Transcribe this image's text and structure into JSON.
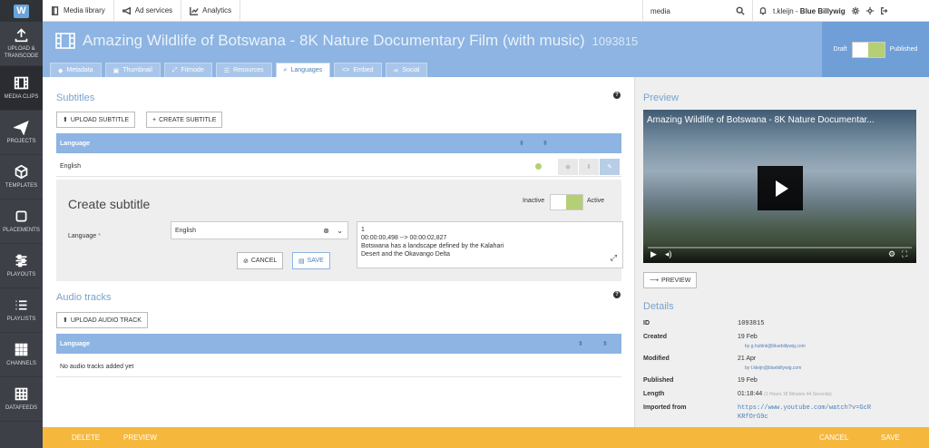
{
  "nav": {
    "items": [
      {
        "label": "UPLOAD &\nTRANSCODE",
        "icon": "upload-icon"
      },
      {
        "label": "MEDIA CLIPS",
        "icon": "film-icon"
      },
      {
        "label": "PROJECTS",
        "icon": "paper-plane-icon"
      },
      {
        "label": "TEMPLATES",
        "icon": "cube-icon"
      },
      {
        "label": "PLACEMENTS",
        "icon": "square-icon"
      },
      {
        "label": "PLAYOUTS",
        "icon": "sliders-icon"
      },
      {
        "label": "PLAYLISTS",
        "icon": "list-icon"
      },
      {
        "label": "CHANNELS",
        "icon": "grid-icon"
      },
      {
        "label": "DATAFEEDS",
        "icon": "table-icon"
      }
    ]
  },
  "topbar": {
    "media_library": "Media library",
    "ad_services": "Ad services",
    "analytics": "Analytics",
    "search_value": "media",
    "user": "t.kleijn",
    "account": "Blue Billywig"
  },
  "header": {
    "title": "Amazing Wildlife of Botswana - 8K Nature Documentary Film (with music)",
    "id": "1093815",
    "draft_label": "Draft",
    "published_label": "Published"
  },
  "tabs": [
    "Metadata",
    "Thumbnail",
    "Fitmode",
    "Resources",
    "Languages",
    "Embed",
    "Social"
  ],
  "subtitles": {
    "heading": "Subtitles",
    "upload_label": "UPLOAD SUBTITLE",
    "create_label": "CREATE SUBTITLE",
    "col_language": "Language",
    "rows": [
      {
        "language": "English"
      }
    ]
  },
  "create": {
    "heading": "Create subtitle",
    "inactive": "Inactive",
    "active": "Active",
    "language_label": "Language",
    "required_mark": "*",
    "language_value": "English",
    "cancel": "CANCEL",
    "save": "SAVE",
    "text_lines": [
      "1",
      "00:00:00,498 --> 00:00:02,827",
      "Botswana has a landscape defined by the Kalahari",
      "Desert and the Okavango Delta"
    ]
  },
  "audio": {
    "heading": "Audio tracks",
    "upload_label": "UPLOAD AUDIO TRACK",
    "col_language": "Language",
    "empty": "No audio tracks added yet"
  },
  "preview": {
    "heading": "Preview",
    "video_title": "Amazing Wildlife of Botswana - 8K Nature Documentar...",
    "button": "PREVIEW"
  },
  "details": {
    "heading": "Details",
    "id_label": "ID",
    "id_value": "1093815",
    "created_label": "Created",
    "created_value": "19 Feb",
    "created_by": "by g.hultink@bluebillywig.com",
    "modified_label": "Modified",
    "modified_value": "21 Apr",
    "modified_by": "by t.kleijn@bluebillywig.com",
    "published_label": "Published",
    "published_value": "19 Feb",
    "length_label": "Length",
    "length_value": "01:18:44",
    "length_detail": "(1 Hours 18 Minutes 44 Seconds)",
    "imported_label": "Imported from",
    "imported_value": "https://www.youtube.com/watch?v=GcRKRfOrG9c"
  },
  "footer": {
    "delete": "DELETE",
    "preview": "PREVIEW",
    "cancel": "CANCEL",
    "save": "SAVE"
  }
}
